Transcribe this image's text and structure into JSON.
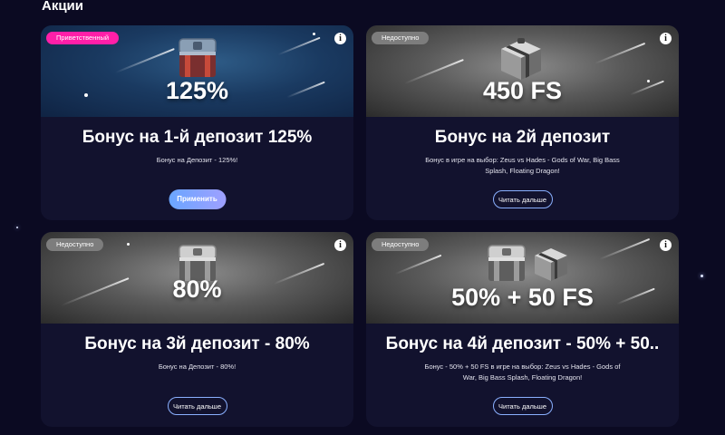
{
  "section": {
    "title": "Акции"
  },
  "cards": [
    {
      "badge": "Приветственный",
      "amount": "125%",
      "title": "Бонус на 1-й депозит 125%",
      "description": "Бонус на Депозит - 125%!",
      "button": "Применить"
    },
    {
      "badge": "Недоступно",
      "amount": "450 FS",
      "title": "Бонус на 2й депозит",
      "description": "Бонус в игре на выбор: Zeus vs Hades - Gods of War, Big Bass Splash, Floating Dragon!",
      "button": "Читать дальше"
    },
    {
      "badge": "Недоступно",
      "amount": "80%",
      "title": "Бонус на 3й депозит - 80%",
      "description": "Бонус на Депозит - 80%!",
      "button": "Читать дальше"
    },
    {
      "badge": "Недоступно",
      "amount": "50% + 50 FS",
      "title": "Бонус на 4й депозит - 50% + 50..",
      "description": "Бонус - 50% + 50 FS в игре на выбор: Zeus vs Hades - Gods of War, Big Bass Splash, Floating Dragon!",
      "button": "Читать дальше"
    }
  ],
  "info_symbol": "i",
  "colors": {
    "badge_welcome": "#ff1fa8",
    "badge_unavailable": "#7d7d7d",
    "page_bg": "#0b0a22",
    "card_bg": "#12122e"
  },
  "icons": [
    "info-icon",
    "bonus-chest-icon",
    "gift-box-icon"
  ]
}
